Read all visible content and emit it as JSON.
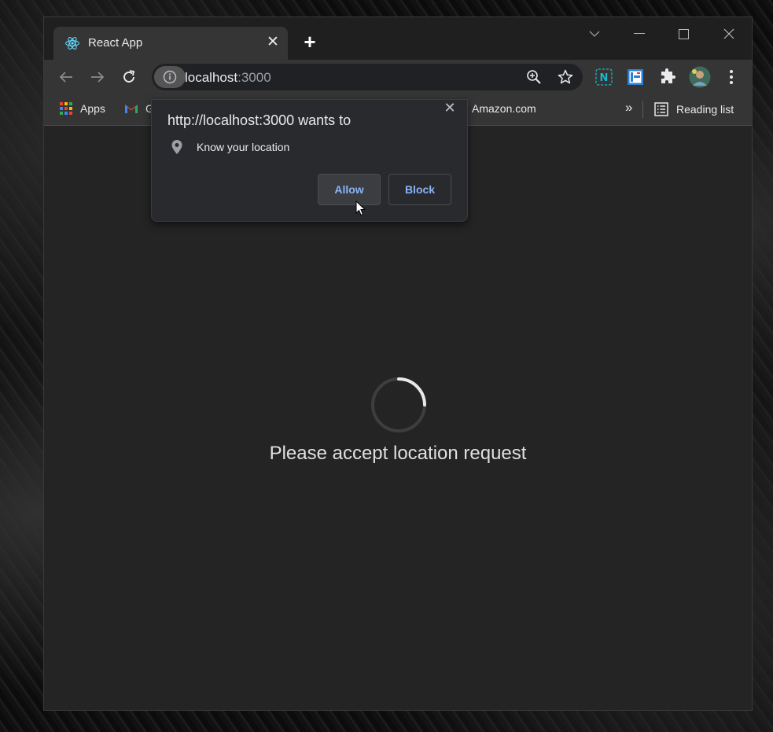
{
  "tab": {
    "title": "React App",
    "icon": "react-logo-icon",
    "close": "✕"
  },
  "new_tab": "+",
  "window_controls": [
    "chevron-down-icon",
    "minimize-icon",
    "maximize-icon",
    "close-icon"
  ],
  "address": {
    "host": "localhost",
    "port": ":3000"
  },
  "bookmarks": {
    "apps": "Apps",
    "gmail_partial": "G",
    "amazon": "Amazon.com",
    "overflow": "»",
    "reading_list": "Reading list"
  },
  "permission_popup": {
    "title": "http://localhost:3000 wants to",
    "permission": "Know your location",
    "allow": "Allow",
    "block": "Block",
    "close": "✕"
  },
  "page": {
    "message": "Please accept location request"
  },
  "colors": {
    "accent_blue": "#8ab4f8",
    "react_cyan": "#61dafb"
  }
}
